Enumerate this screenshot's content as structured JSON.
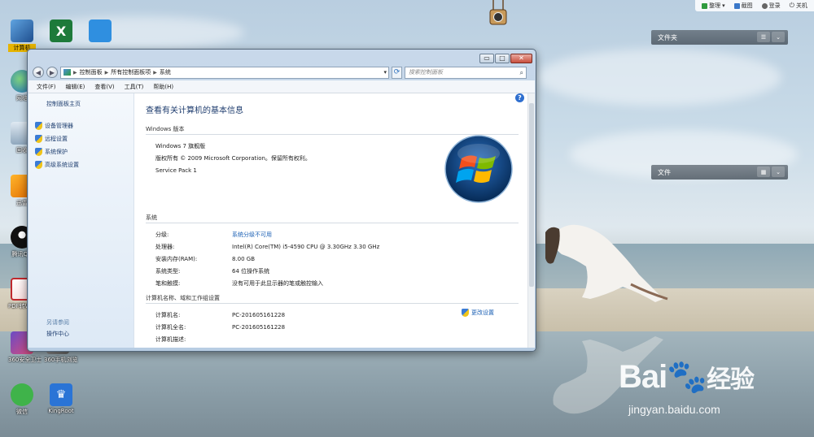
{
  "topbar": {
    "items": [
      {
        "label": "整理",
        "icon": "organize-icon"
      },
      {
        "label": "截图",
        "icon": "screenshot-icon"
      },
      {
        "label": "登录",
        "icon": "login-icon"
      },
      {
        "label": "关机",
        "icon": "power-icon"
      }
    ]
  },
  "desktop_icons": [
    {
      "label": "计算机",
      "icon": "computer-icon"
    },
    {
      "label": "",
      "icon": "excel-icon"
    },
    {
      "label": "",
      "icon": "baidu-netdisk-icon"
    },
    {
      "label": "网络",
      "icon": "network-icon"
    },
    {
      "label": "回收",
      "icon": "recycle-bin-icon"
    },
    {
      "label": "迅雷",
      "icon": "security-icon"
    },
    {
      "label": "腾讯QQ",
      "icon": "qq-icon"
    },
    {
      "label": "PDF转Word",
      "icon": "pdf-icon"
    },
    {
      "label": "360安全卫士",
      "icon": "360-icon"
    },
    {
      "label": "360手机浏览",
      "icon": "browser-icon"
    },
    {
      "label": "微信",
      "icon": "wechat-icon"
    },
    {
      "label": "KingRoot",
      "icon": "kingroot-icon"
    }
  ],
  "gadgets": [
    {
      "title": "文件夹"
    },
    {
      "title": "文件"
    }
  ],
  "window": {
    "address": {
      "crumbs": [
        "控制面板",
        "所有控制面板项",
        "系统"
      ]
    },
    "search_placeholder": "搜索控制面板",
    "menu": [
      "文件(F)",
      "编辑(E)",
      "查看(V)",
      "工具(T)",
      "帮助(H)"
    ],
    "sidebar": {
      "home": "控制面板主页",
      "tasks": [
        "设备管理器",
        "远程设置",
        "系统保护",
        "高级系统设置"
      ],
      "see_also": "另请参阅",
      "action_center": "操作中心"
    },
    "main": {
      "title": "查看有关计算机的基本信息",
      "edition_header": "Windows 版本",
      "edition_lines": [
        "Windows 7 旗舰版",
        "版权所有 © 2009 Microsoft Corporation。保留所有权利。",
        "Service Pack 1"
      ],
      "system_header": "系统",
      "system_rows": [
        {
          "key": "分级:",
          "value": "系统分级不可用",
          "link": true
        },
        {
          "key": "处理器:",
          "value": "Intel(R) Core(TM) i5-4590 CPU @ 3.30GHz   3.30 GHz",
          "link": false
        },
        {
          "key": "安装内存(RAM):",
          "value": "8.00 GB",
          "link": false
        },
        {
          "key": "系统类型:",
          "value": "64 位操作系统",
          "link": false
        },
        {
          "key": "笔和触摸:",
          "value": "没有可用于此显示器的笔或触控输入",
          "link": false
        }
      ],
      "computer_header": "计算机名称、域和工作组设置",
      "computer_rows": [
        {
          "key": "计算机名:",
          "value": "PC-201605161228"
        },
        {
          "key": "计算机全名:",
          "value": "PC-201605161228"
        },
        {
          "key": "计算机描述:",
          "value": ""
        }
      ],
      "change_settings": "更改设置"
    }
  },
  "watermark": {
    "brand": "Bai",
    "brand2": "经验",
    "url": "jingyan.baidu.com"
  }
}
